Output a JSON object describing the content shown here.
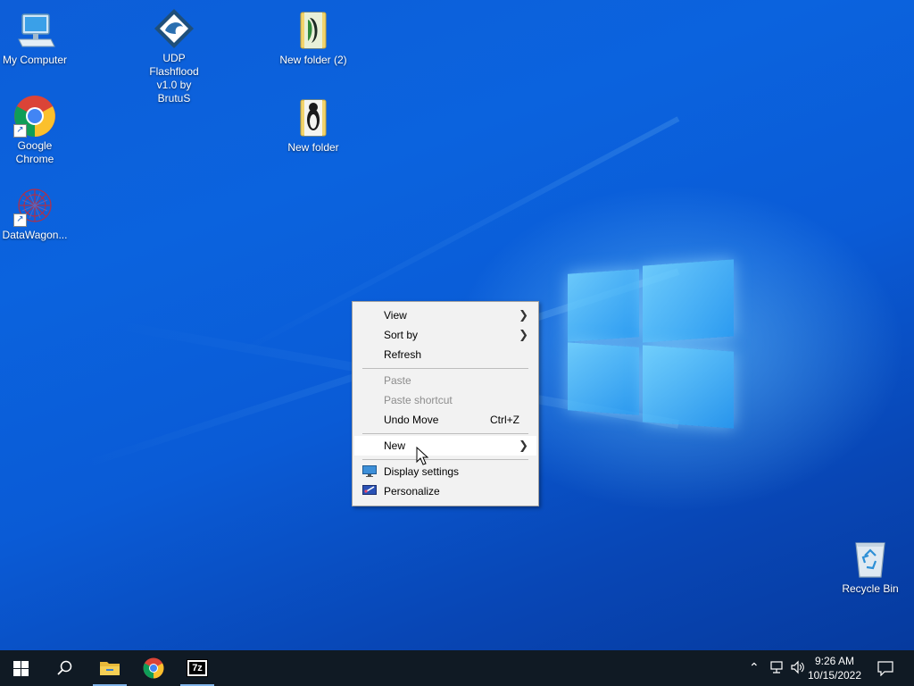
{
  "desktop_icons": {
    "my_computer": "My Computer",
    "udp": "UDP Flashflood v1.0 by BrutuS",
    "new_folder_2": "New folder (2)",
    "chrome": "Google Chrome",
    "new_folder": "New folder",
    "datawagon": "DataWagon...",
    "recycle_bin": "Recycle Bin"
  },
  "context_menu": {
    "view": "View",
    "sort_by": "Sort by",
    "refresh": "Refresh",
    "paste": "Paste",
    "paste_shortcut": "Paste shortcut",
    "undo_move": "Undo Move",
    "undo_shortcut": "Ctrl+Z",
    "new": "New",
    "display_settings": "Display settings",
    "personalize": "Personalize"
  },
  "taskbar": {
    "pinned": [
      {
        "name": "start",
        "icon": "windows-logo-icon"
      },
      {
        "name": "search",
        "icon": "search-icon"
      },
      {
        "name": "file-explorer",
        "icon": "folder-icon"
      },
      {
        "name": "chrome",
        "icon": "chrome-icon"
      },
      {
        "name": "7zip",
        "icon": "7zip-icon",
        "label": "7z"
      }
    ],
    "time": "9:26 AM",
    "date": "10/15/2022"
  },
  "colors": {
    "taskbar": "#101a24",
    "menu_bg": "#f2f2f2",
    "accent": "#0a5bd6"
  }
}
